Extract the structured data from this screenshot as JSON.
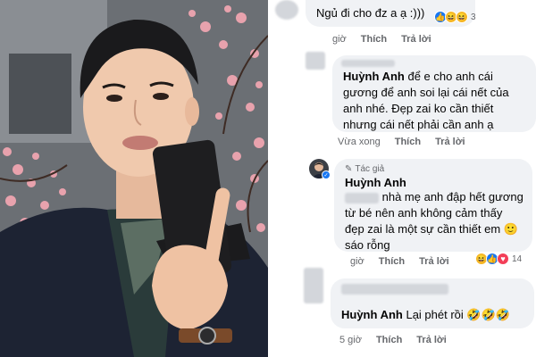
{
  "comments": [
    {
      "text": "Ngủ đi cho đz a ạ :)))",
      "reactions": {
        "count": "3",
        "icons": [
          "like-icon",
          "haha-icon",
          "haha-icon"
        ]
      },
      "actions": {
        "time": "giờ",
        "like": "Thích",
        "reply": "Trả lời"
      }
    },
    {
      "name": "Huỳnh Anh",
      "text": "để e cho anh cái gương để anh soi lại cái nết của anh nhé. Đẹp zai ko cần thiết nhưng cái nết phải cần anh ạ",
      "lines": [
        "để e cho anh cái",
        "gương để anh soi lại cái nết của",
        "anh nhé. Đẹp zai ko cần thiết",
        "nhưng cái nết phải cần anh ạ"
      ],
      "actions": {
        "time": "Vừa xong",
        "like": "Thích",
        "reply": "Trả lời"
      }
    },
    {
      "author_tag": "Tác giả",
      "name": "Huỳnh Anh",
      "lines": [
        "nhà mẹ anh đập hết gương",
        "từ bé nên anh không cảm thấy",
        "đẹp zai là một sự cần thiết em",
        "sáo rỗng"
      ],
      "emoji": "🙂",
      "reactions": {
        "count": "14",
        "icons": [
          "haha-icon",
          "like-icon",
          "love-icon"
        ]
      },
      "actions": {
        "time": "giờ",
        "like": "Thích",
        "reply": "Trả lời"
      }
    },
    {
      "name": "Huỳnh Anh",
      "text": "Lại phét rồi",
      "emoji": "🤣🤣🤣",
      "actions": {
        "time": "5 giờ",
        "like": "Thích",
        "reply": "Trả lời"
      }
    }
  ]
}
